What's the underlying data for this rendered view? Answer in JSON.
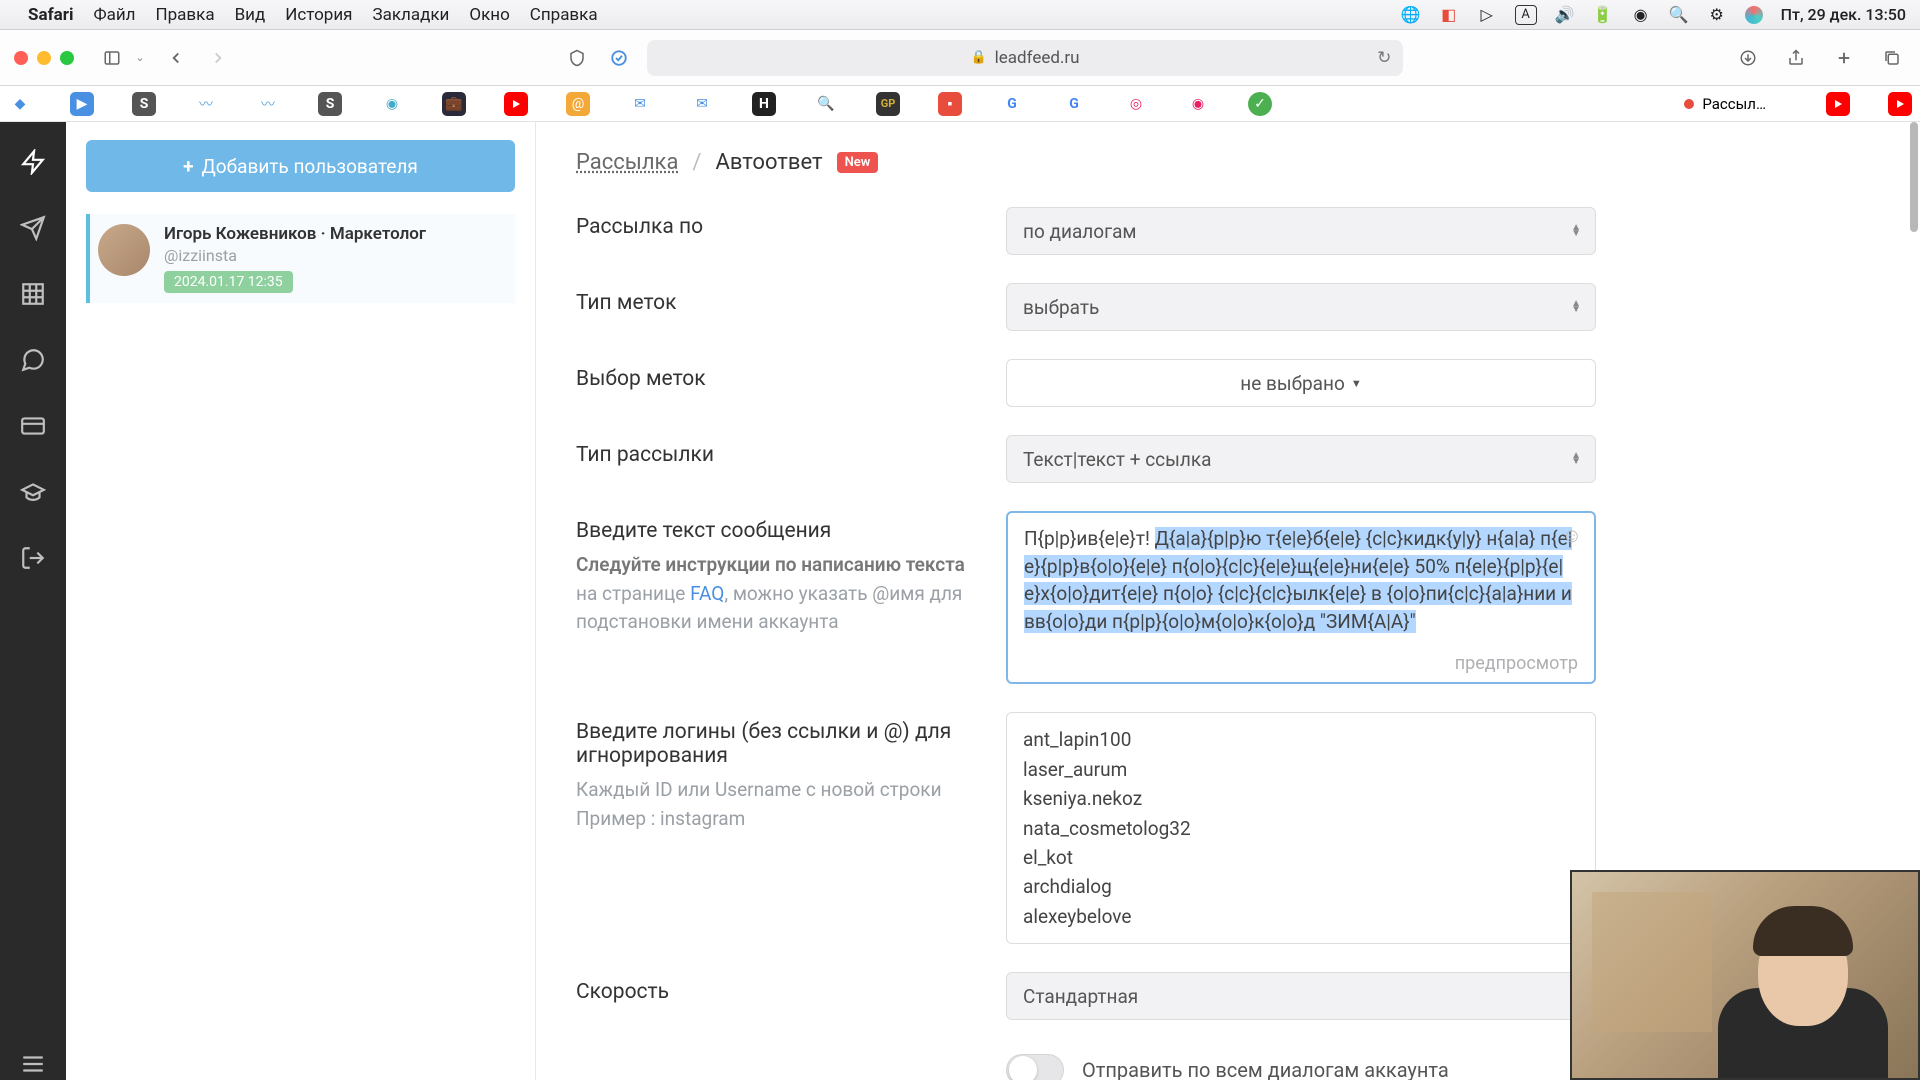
{
  "menubar": {
    "app": "Safari",
    "items": [
      "Файл",
      "Правка",
      "Вид",
      "История",
      "Закладки",
      "Окно",
      "Справка"
    ],
    "clock": "Пт, 29 дек. 13:50"
  },
  "toolbar": {
    "url": "leadfeed.ru"
  },
  "favbar": {
    "active_tab": "Рассыл…"
  },
  "sidebar": {
    "add_user": "Добавить пользователя",
    "user": {
      "name": "Игорь Кожевников · Маркетолог",
      "handle": "@izziinsta",
      "chip": "2024.01.17 12:35"
    }
  },
  "breadcrumb": {
    "root": "Рассылка",
    "sep": "/",
    "current": "Автоответ",
    "badge": "New"
  },
  "form": {
    "send_by": {
      "label": "Рассылка по",
      "value": "по диалогам"
    },
    "tag_type": {
      "label": "Тип меток",
      "value": "выбрать"
    },
    "tag_pick": {
      "label": "Выбор меток",
      "value": "не выбрано"
    },
    "send_type": {
      "label": "Тип рассылки",
      "value": "Текст|текст + ссылка"
    },
    "message": {
      "label": "Введите текст сообщения",
      "hint_bold": "Следуйте инструкции по написанию текста",
      "hint_tail1": " на странице ",
      "faq": "FAQ",
      "hint_tail2": ", можно указать @имя для подстановки имени аккаунта",
      "text_pre": "П{р|р}ив{е|е}т! ",
      "text_sel": "Д{а|а}{р|р}ю т{е|е}б{е|е} {с|с}кидк{у|у} н{а|а} п{е|е}{р|р}в{о|о}{е|е} п{о|о}{с|с}{е|е}щ{е|е}ни{е|е} 50% п{е|е}{р|р}{е|е}х{о|о}дит{е|е} п{о|о} {с|с}{с|с}ылк{е|е} в {о|о}пи{с|с}{а|а}нии и вв{о|о}ди п{р|р}{о|о}м{о|о}к{о|о}д \"ЗИМ{А|А}\"",
      "preview": "предпросмотр"
    },
    "logins": {
      "label": "Введите логины (без ссылки и @) для игнорирования",
      "hint1": "Каждый ID или Username с новой строки",
      "hint2": "Пример : instagram",
      "values": [
        "ant_lapin100",
        "laser_aurum",
        "kseniya.nekoz",
        "nata_cosmetolog32",
        "el_kot",
        "archdialog",
        "alexeybelove"
      ]
    },
    "speed": {
      "label": "Скорость",
      "value": "Стандартная"
    },
    "toggle_label": "Отправить по всем диалогам аккаунта"
  }
}
